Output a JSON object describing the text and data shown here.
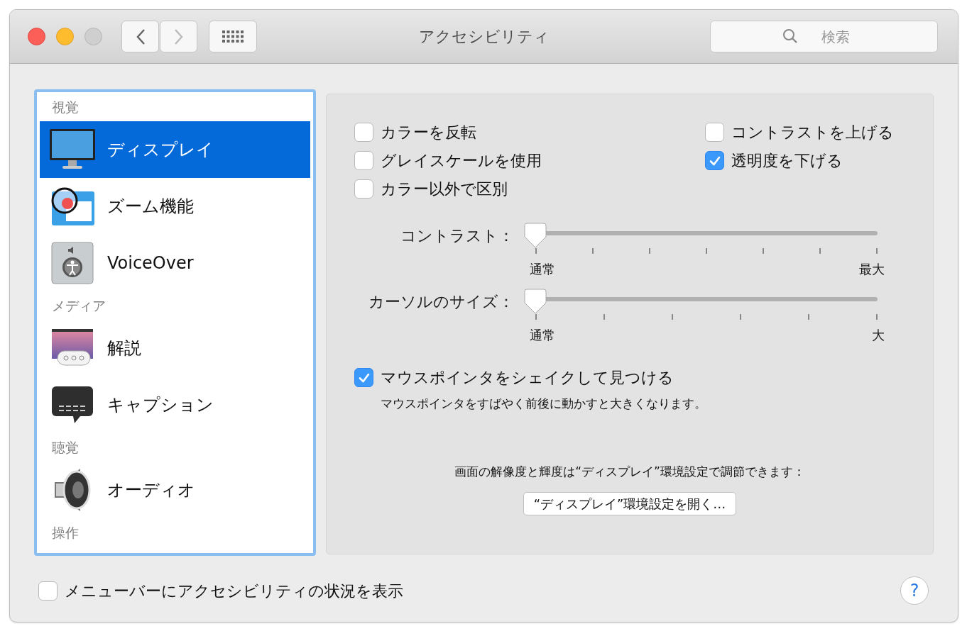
{
  "window": {
    "title": "アクセシビリティ",
    "search": {
      "placeholder": "検索"
    }
  },
  "sidebar": {
    "items": [
      {
        "kind": "header",
        "label": "視覚"
      },
      {
        "kind": "item",
        "label": "ディスプレイ",
        "selected": true
      },
      {
        "kind": "item",
        "label": "ズーム機能",
        "selected": false
      },
      {
        "kind": "item",
        "label": "VoiceOver",
        "selected": false
      },
      {
        "kind": "header",
        "label": "メディア"
      },
      {
        "kind": "item",
        "label": "解説",
        "selected": false
      },
      {
        "kind": "item",
        "label": "キャプション",
        "selected": false
      },
      {
        "kind": "header",
        "label": "聴覚"
      },
      {
        "kind": "item",
        "label": "オーディオ",
        "selected": false
      },
      {
        "kind": "header",
        "label": "操作"
      }
    ]
  },
  "panel": {
    "left_options": [
      {
        "label": "カラーを反転",
        "checked": false
      },
      {
        "label": "グレイスケールを使用",
        "checked": false
      },
      {
        "label": "カラー以外で区別",
        "checked": false
      }
    ],
    "right_options": [
      {
        "label": "コントラストを上げる",
        "checked": false
      },
      {
        "label": "透明度を下げる",
        "checked": true
      }
    ],
    "sliders": [
      {
        "label": "コントラスト：",
        "level": 0,
        "min_label": "通常",
        "max_label": "最大"
      },
      {
        "label": "カーソルのサイズ：",
        "level": 0,
        "min_label": "通常",
        "max_label": "大"
      }
    ],
    "shake": {
      "label": "マウスポインタをシェイクして見つける",
      "checked": true,
      "description": "マウスポインタをすばやく前後に動かすと大きくなります。"
    },
    "note": "画面の解像度と輝度は“ディスプレイ”環境設定で調節できます：",
    "button": "“ディスプレイ”環境設定を開く…"
  },
  "footer": {
    "checkbox": {
      "label": "メニューバーにアクセシビリティの状況を表示",
      "checked": false
    },
    "help": "?"
  }
}
